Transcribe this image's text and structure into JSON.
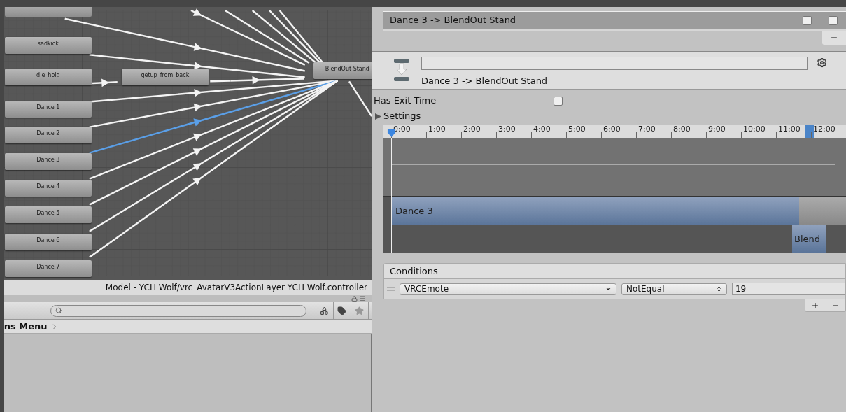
{
  "graph": {
    "states": [
      {
        "label": "sadkick",
        "kind": "direct",
        "transition_selected": false
      },
      {
        "label": "die_hold",
        "kind": "via",
        "transition_selected": false
      },
      {
        "label": "Dance 1",
        "kind": "direct",
        "transition_selected": false
      },
      {
        "label": "Dance 2",
        "kind": "direct",
        "transition_selected": false
      },
      {
        "label": "Dance 3",
        "kind": "direct",
        "transition_selected": true
      },
      {
        "label": "Dance 4",
        "kind": "direct",
        "transition_selected": false
      },
      {
        "label": "Dance 5",
        "kind": "direct",
        "transition_selected": false
      },
      {
        "label": "Dance 6",
        "kind": "direct",
        "transition_selected": false
      },
      {
        "label": "Dance 7",
        "kind": "direct",
        "transition_selected": false
      }
    ],
    "intermediate": {
      "label": "getup_from_back"
    },
    "target": {
      "label": "BlendOut Stand"
    },
    "footer_path": "Model - YCH Wolf/vrc_AvatarV3ActionLayer YCH Wolf.controller"
  },
  "project": {
    "breadcrumb": "ns Menu"
  },
  "inspector": {
    "transitions": [
      {
        "label": "Dance 3 -> BlendOut Stand",
        "solo": false,
        "mute": false
      }
    ],
    "header_label": "Dance 3 -> BlendOut Stand",
    "has_exit_time": {
      "label": "Has Exit Time",
      "checked": false
    },
    "settings": {
      "label": "Settings",
      "expanded": false
    },
    "timeline": {
      "ticks": [
        "0:00",
        "1:00",
        "2:00",
        "3:00",
        "4:00",
        "5:00",
        "6:00",
        "7:00",
        "8:00",
        "9:00",
        "10:00",
        "11:00",
        "12:00"
      ],
      "source_clip": "Dance 3",
      "dest_clip": "Blend"
    },
    "conditions": {
      "title": "Conditions",
      "rows": [
        {
          "parameter": "VRCEmote",
          "mode": "NotEqual",
          "value": "19"
        }
      ]
    }
  }
}
